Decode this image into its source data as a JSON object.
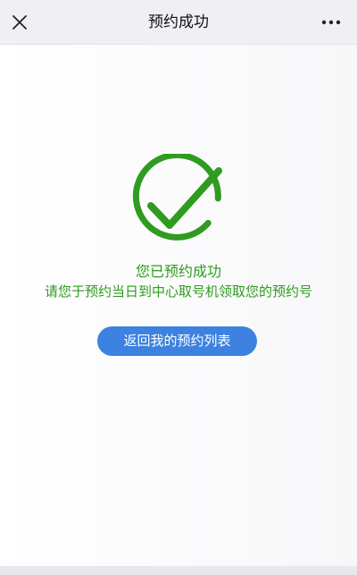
{
  "header": {
    "title": "预约成功",
    "close_icon": "close-icon",
    "more_icon": "more-icon"
  },
  "result": {
    "icon": "check-circle-icon",
    "status_text": "您已预约成功",
    "instruction_text": "请您于预约当日到中心取号机领取您的预约号"
  },
  "actions": {
    "return_label": "返回我的预约列表"
  },
  "colors": {
    "success_green": "#2e9b1f",
    "button_blue": "#3d82e0",
    "header_bg": "#efeff4"
  }
}
